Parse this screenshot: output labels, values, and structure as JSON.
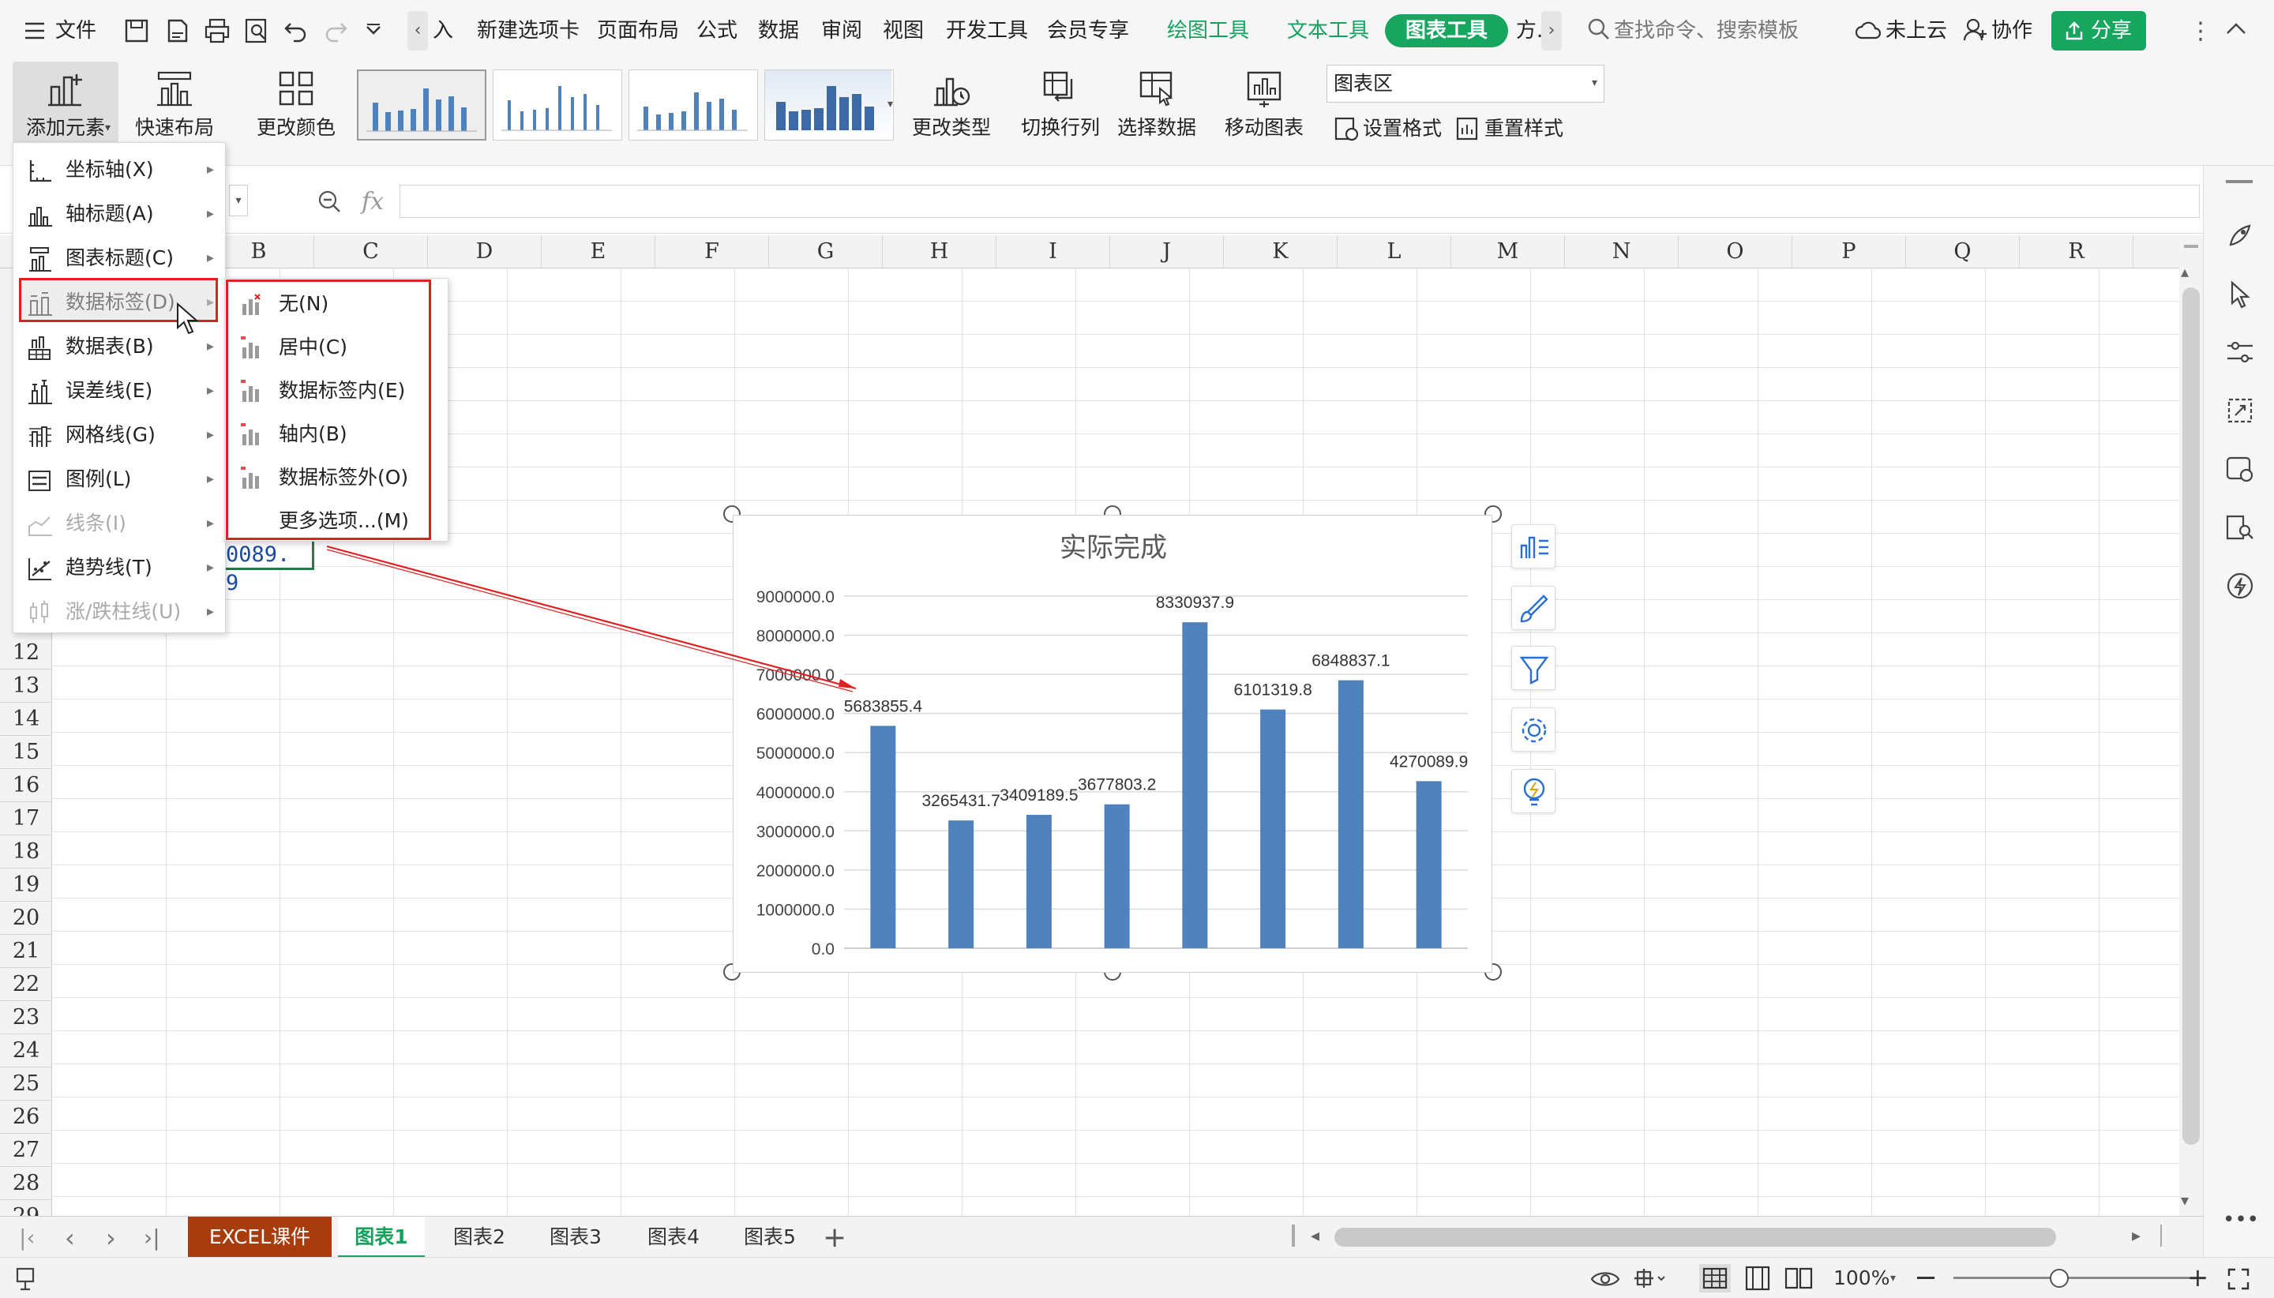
{
  "menubar": {
    "file": "文件",
    "tabs": [
      "入",
      "新建选项卡",
      "页面布局",
      "公式",
      "数据",
      "审阅",
      "视图",
      "开发工具",
      "会员专享"
    ],
    "context_tabs": [
      "绘图工具",
      "文本工具"
    ],
    "active_tab": "图表工具",
    "more_tab": "方.",
    "search_placeholder": "查找命令、搜索模板",
    "cloud": "未上云",
    "collab": "协作",
    "share": "分享"
  },
  "ribbon": {
    "add_element": "添加元素",
    "quick_layout": "快速布局",
    "change_color": "更改颜色",
    "change_type": "更改类型",
    "switch_rowcol": "切换行列",
    "select_data": "选择数据",
    "move_chart": "移动图表",
    "chart_area_select": "图表区",
    "format": "设置格式",
    "reset_style": "重置样式"
  },
  "formula": {
    "fx": "fx"
  },
  "columns": [
    "B",
    "C",
    "D",
    "E",
    "F",
    "G",
    "H",
    "I",
    "J",
    "K",
    "L",
    "M",
    "N",
    "O",
    "P",
    "Q",
    "R"
  ],
  "rows": [
    "12",
    "13",
    "14",
    "15",
    "16",
    "17",
    "18",
    "19",
    "20",
    "21",
    "22",
    "23",
    "24",
    "25",
    "26",
    "27",
    "28",
    "29"
  ],
  "cell_partial": "0089. 9",
  "add_element_menu": [
    {
      "label": "坐标轴(X)",
      "icon": "axis-icon",
      "disabled": false
    },
    {
      "label": "轴标题(A)",
      "icon": "axis-title-icon",
      "disabled": false
    },
    {
      "label": "图表标题(C)",
      "icon": "chart-title-icon",
      "disabled": false
    },
    {
      "label": "数据标签(D)",
      "icon": "data-label-icon",
      "disabled": false
    },
    {
      "label": "数据表(B)",
      "icon": "data-table-icon",
      "disabled": false
    },
    {
      "label": "误差线(E)",
      "icon": "error-bar-icon",
      "disabled": false
    },
    {
      "label": "网格线(G)",
      "icon": "gridline-icon",
      "disabled": false
    },
    {
      "label": "图例(L)",
      "icon": "legend-icon",
      "disabled": false
    },
    {
      "label": "线条(I)",
      "icon": "line-icon",
      "disabled": true
    },
    {
      "label": "趋势线(T)",
      "icon": "trendline-icon",
      "disabled": false
    },
    {
      "label": "涨/跌柱线(U)",
      "icon": "updown-bar-icon",
      "disabled": true
    }
  ],
  "data_label_submenu": [
    "无(N)",
    "居中(C)",
    "数据标签内(E)",
    "轴内(B)",
    "数据标签外(O)",
    "更多选项...(M)"
  ],
  "chart_data": {
    "type": "bar",
    "title": "实际完成",
    "categories": [
      "",
      "",
      "",
      "",
      "",
      "",
      "",
      ""
    ],
    "values": [
      5683855.4,
      3265431.7,
      3409189.5,
      3677803.2,
      8330937.9,
      6101319.8,
      6848837.1,
      4270089.9
    ],
    "data_labels": [
      "5683855.4",
      "3265431.7",
      "3409189.5",
      "3677803.2",
      "8330937.9",
      "6101319.8",
      "6848837.1",
      "4270089.9"
    ],
    "ylim": [
      0,
      9000000
    ],
    "yticks": [
      "0.0",
      "1000000.0",
      "2000000.0",
      "3000000.0",
      "4000000.0",
      "5000000.0",
      "6000000.0",
      "7000000.0",
      "8000000.0",
      "9000000.0"
    ],
    "color": "#4f81bd",
    "grid": true,
    "legend": "none"
  },
  "sheet_tabs": [
    "EXCEL课件",
    "图表1",
    "图表2",
    "图表3",
    "图表4",
    "图表5"
  ],
  "status": {
    "zoom": "100%"
  },
  "colors": {
    "accent": "#17a65f",
    "highlight": "#e02020",
    "excel_tab": "#a83c0d"
  }
}
